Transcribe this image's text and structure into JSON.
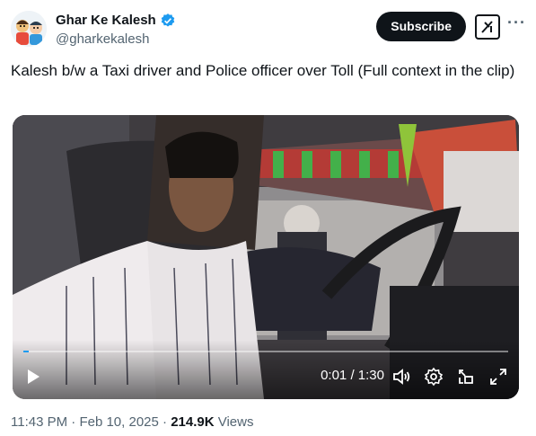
{
  "author": {
    "display_name": "Ghar Ke Kalesh",
    "handle": "@gharkekalesh",
    "verified": true
  },
  "actions": {
    "subscribe_label": "Subscribe",
    "grok_icon": "grok-icon",
    "more_icon": "more-icon"
  },
  "tweet": {
    "text": "Kalesh b/w a Taxi driver and Police officer over Toll (Full context in the clip)"
  },
  "video": {
    "current_time": "0:01",
    "separator": " / ",
    "duration": "1:30",
    "progress_fraction": 0.011,
    "controls": [
      "play-icon",
      "volume-icon",
      "settings-icon",
      "pip-icon",
      "fullscreen-icon"
    ]
  },
  "meta": {
    "time": "11:43 PM",
    "dot1": " · ",
    "date": "Feb 10, 2025",
    "dot2": " · ",
    "views_count": "214.9K",
    "views_label": " Views"
  },
  "colors": {
    "accent": "#1d9bf0",
    "text": "#0f1419",
    "secondary": "#536471"
  }
}
